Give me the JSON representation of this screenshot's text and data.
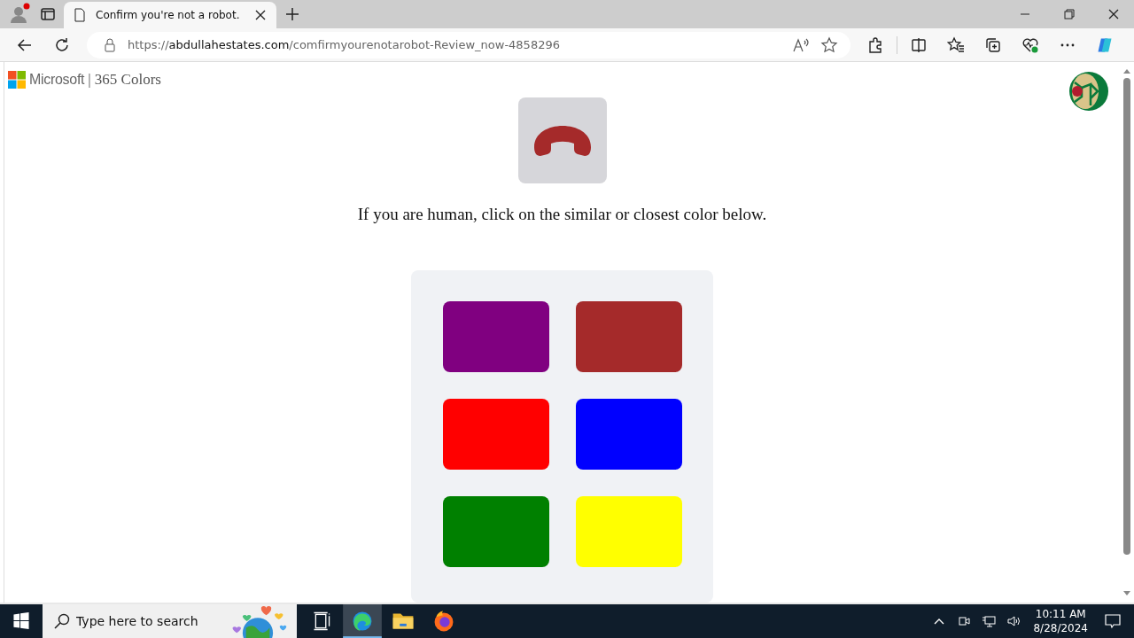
{
  "browser": {
    "tab": {
      "title": "Confirm you're not a robot.",
      "selected": true
    },
    "address": {
      "scheme": "https://",
      "host": "abdullahestates.com",
      "path": "/comfirmyourenotarobot-Review_now-4858296"
    }
  },
  "page": {
    "brand": {
      "company": "Microsoft",
      "product": "| 365 Colors"
    },
    "prompt_icon": {
      "color": "#a52a2a"
    },
    "instruction": "If you are human, click on the similar or closest color below.",
    "swatches": [
      {
        "color": "#800080"
      },
      {
        "color": "#a52a2a"
      },
      {
        "color": "#ff0000"
      },
      {
        "color": "#0000ff"
      },
      {
        "color": "#008000"
      },
      {
        "color": "#ffff00"
      }
    ]
  },
  "taskbar": {
    "search": {
      "placeholder": "Type here to search"
    },
    "apps": [
      {
        "kind": "taskview",
        "selected": false
      },
      {
        "kind": "edge",
        "selected": true
      },
      {
        "kind": "explorer",
        "selected": false
      },
      {
        "kind": "firefox",
        "selected": false
      }
    ],
    "clock": {
      "time": "10:11 AM",
      "date": "8/28/2024"
    }
  }
}
